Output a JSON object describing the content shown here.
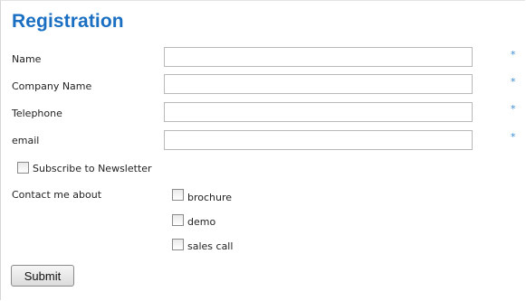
{
  "form": {
    "title": "Registration",
    "required_marker": "*",
    "fields": [
      {
        "label": "Name",
        "value": "",
        "placeholder": ""
      },
      {
        "label": "Company Name",
        "value": "",
        "placeholder": ""
      },
      {
        "label": "Telephone",
        "value": "",
        "placeholder": ""
      },
      {
        "label": "email",
        "value": "",
        "placeholder": ""
      }
    ],
    "newsletter": {
      "label": "Subscribe to Newsletter",
      "checked": false
    },
    "contact": {
      "label": "Contact me about",
      "options": [
        {
          "label": "brochure",
          "checked": false
        },
        {
          "label": "demo",
          "checked": false
        },
        {
          "label": "sales call",
          "checked": false
        }
      ]
    },
    "submit_label": "Submit"
  },
  "colors": {
    "title": "#1a6fc2",
    "required_marker": "#3a8cd6",
    "input_border": "#b9b9b9"
  }
}
